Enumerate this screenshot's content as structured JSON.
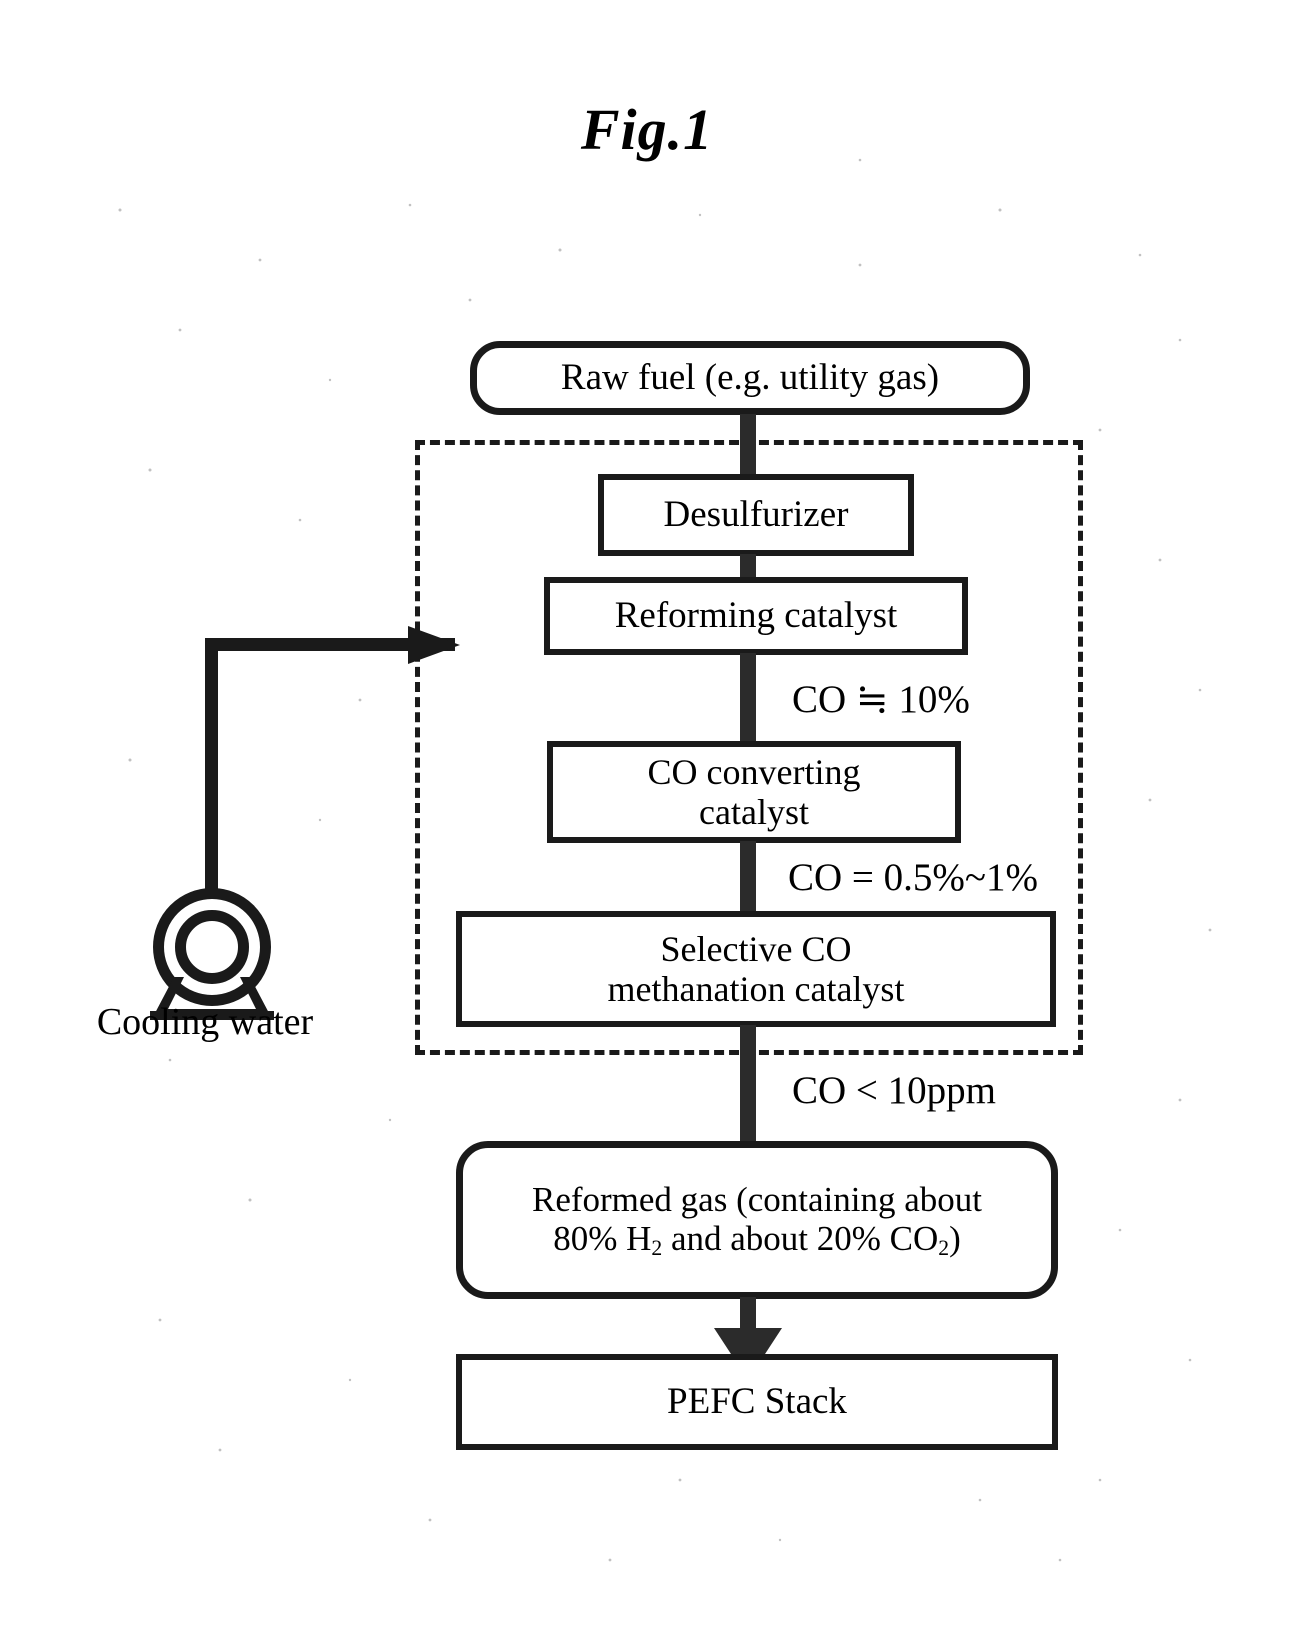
{
  "figure": {
    "title": "Fig.1",
    "type": "process-flow-diagram"
  },
  "boxes": {
    "raw_fuel": "Raw fuel (e.g. utility gas)",
    "desulfurizer": "Desulfurizer",
    "reforming_catalyst": "Reforming catalyst",
    "co_converting_catalyst_line1": "CO converting",
    "co_converting_catalyst_line2": "catalyst",
    "methanation_catalyst_line1": "Selective CO",
    "methanation_catalyst_line2": "methanation catalyst",
    "reformed_gas_line1": "Reformed gas (containing about",
    "reformed_gas_line2_a": "80% H",
    "reformed_gas_line2_sub_a": "2",
    "reformed_gas_line2_b": " and about 20% CO",
    "reformed_gas_line2_sub_b": "2",
    "reformed_gas_line2_c": ")",
    "pefc_stack": "PEFC Stack"
  },
  "flow_labels": {
    "after_reforming": "CO ≒ 10%",
    "after_co_converting": "CO = 0.5%~1%",
    "after_methanation": "CO < 10ppm"
  },
  "cooling_water": {
    "label": "Cooling water",
    "pump_icon": "pump-icon"
  },
  "colors": {
    "ink": "#1a1a1a",
    "connector": "#2b2b2b",
    "paper": "#ffffff"
  }
}
